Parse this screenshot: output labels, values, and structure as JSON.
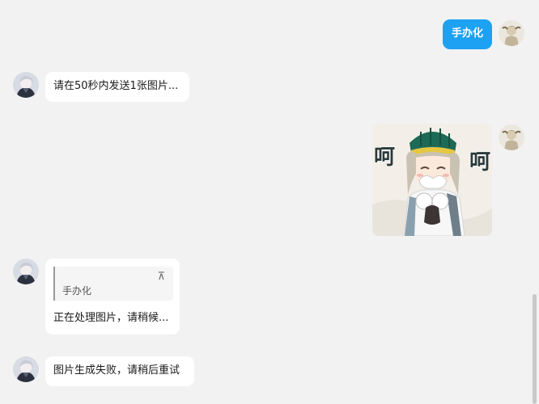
{
  "messages": [
    {
      "sender": "self",
      "type": "text",
      "text": "手办化"
    },
    {
      "sender": "bot",
      "type": "text",
      "text": "请在50秒内发送1张图片..."
    },
    {
      "sender": "self",
      "type": "image",
      "image_text_left": "呵",
      "image_text_right": "呵"
    },
    {
      "sender": "bot",
      "type": "reply",
      "quote_text": "手办化",
      "quote_icon": "pin-icon",
      "text": "正在处理图片，请稍候..."
    },
    {
      "sender": "bot",
      "type": "text",
      "text": "图片生成失败，请稍后重试"
    }
  ],
  "colors": {
    "self_bubble": "#1da1f2",
    "bot_bubble": "#ffffff",
    "background": "#f2f2f2"
  }
}
